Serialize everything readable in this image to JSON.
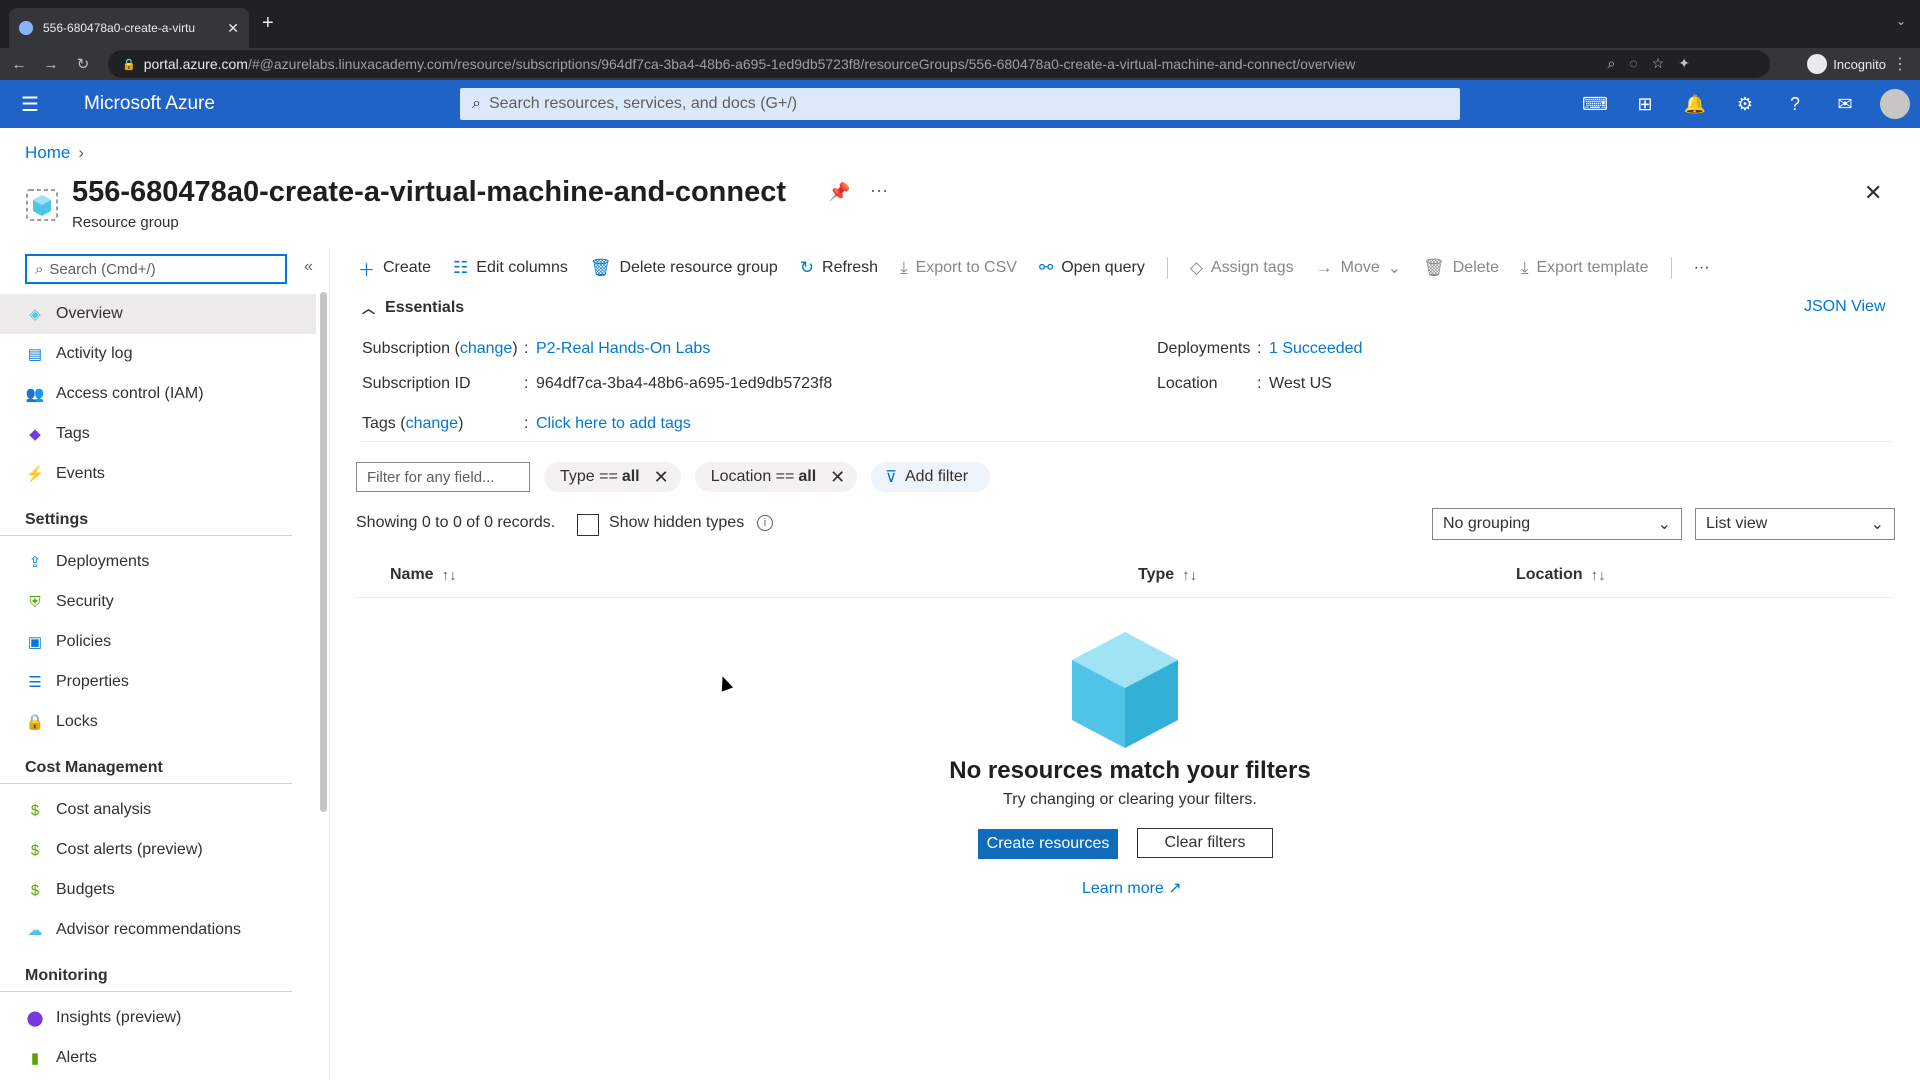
{
  "browser": {
    "tab_title": "556-680478a0-create-a-virtu",
    "url_domain": "portal.azure.com",
    "url_rest": "/#@azurelabs.linuxacademy.com/resource/subscriptions/964df7ca-3ba4-48b6-a695-1ed9db5723f8/resourceGroups/556-680478a0-create-a-virtual-machine-and-connect/overview",
    "profile": "Incognito"
  },
  "azure": {
    "brand": "Microsoft Azure",
    "search_placeholder": "Search resources, services, and docs (G+/)"
  },
  "breadcrumb": {
    "home": "Home"
  },
  "resource": {
    "title": "556-680478a0-create-a-virtual-machine-and-connect",
    "type": "Resource group"
  },
  "sidebar": {
    "search_placeholder": "Search (Cmd+/)",
    "items": [
      {
        "label": "Overview",
        "icon": "cube-icon"
      },
      {
        "label": "Activity log",
        "icon": "log-icon"
      },
      {
        "label": "Access control (IAM)",
        "icon": "people-icon"
      },
      {
        "label": "Tags",
        "icon": "tag-icon"
      },
      {
        "label": "Events",
        "icon": "bolt-icon"
      }
    ],
    "settings_header": "Settings",
    "settings": [
      {
        "label": "Deployments"
      },
      {
        "label": "Security"
      },
      {
        "label": "Policies"
      },
      {
        "label": "Properties"
      },
      {
        "label": "Locks"
      }
    ],
    "cost_header": "Cost Management",
    "cost": [
      {
        "label": "Cost analysis"
      },
      {
        "label": "Cost alerts (preview)"
      },
      {
        "label": "Budgets"
      },
      {
        "label": "Advisor recommendations"
      }
    ],
    "monitoring_header": "Monitoring",
    "monitoring": [
      {
        "label": "Insights (preview)"
      },
      {
        "label": "Alerts"
      }
    ]
  },
  "toolbar": {
    "create": "Create",
    "edit_columns": "Edit columns",
    "delete_rg": "Delete resource group",
    "refresh": "Refresh",
    "export_csv": "Export to CSV",
    "open_query": "Open query",
    "assign_tags": "Assign tags",
    "move": "Move",
    "delete": "Delete",
    "export_template": "Export template"
  },
  "essentials": {
    "header": "Essentials",
    "json_view": "JSON View",
    "subscription_label": "Subscription",
    "change": "change",
    "subscription_value": "P2-Real Hands-On Labs",
    "subscription_id_label": "Subscription ID",
    "subscription_id": "964df7ca-3ba4-48b6-a695-1ed9db5723f8",
    "tags_label": "Tags",
    "tags_value": "Click here to add tags",
    "deployments_label": "Deployments",
    "deployments_value": "1 Succeeded",
    "location_label": "Location",
    "location_value": "West US"
  },
  "filters": {
    "placeholder": "Filter for any field...",
    "type_label": "Type ==",
    "type_value": "all",
    "location_label": "Location ==",
    "location_value": "all",
    "add_filter": "Add filter"
  },
  "list": {
    "records": "Showing 0 to 0 of 0 records.",
    "show_hidden": "Show hidden types",
    "grouping": "No grouping",
    "view": "List view",
    "col_name": "Name",
    "col_type": "Type",
    "col_location": "Location"
  },
  "empty": {
    "title": "No resources match your filters",
    "subtitle": "Try changing or clearing your filters.",
    "create_btn": "Create resources",
    "clear_btn": "Clear filters",
    "learn_more": "Learn more"
  }
}
